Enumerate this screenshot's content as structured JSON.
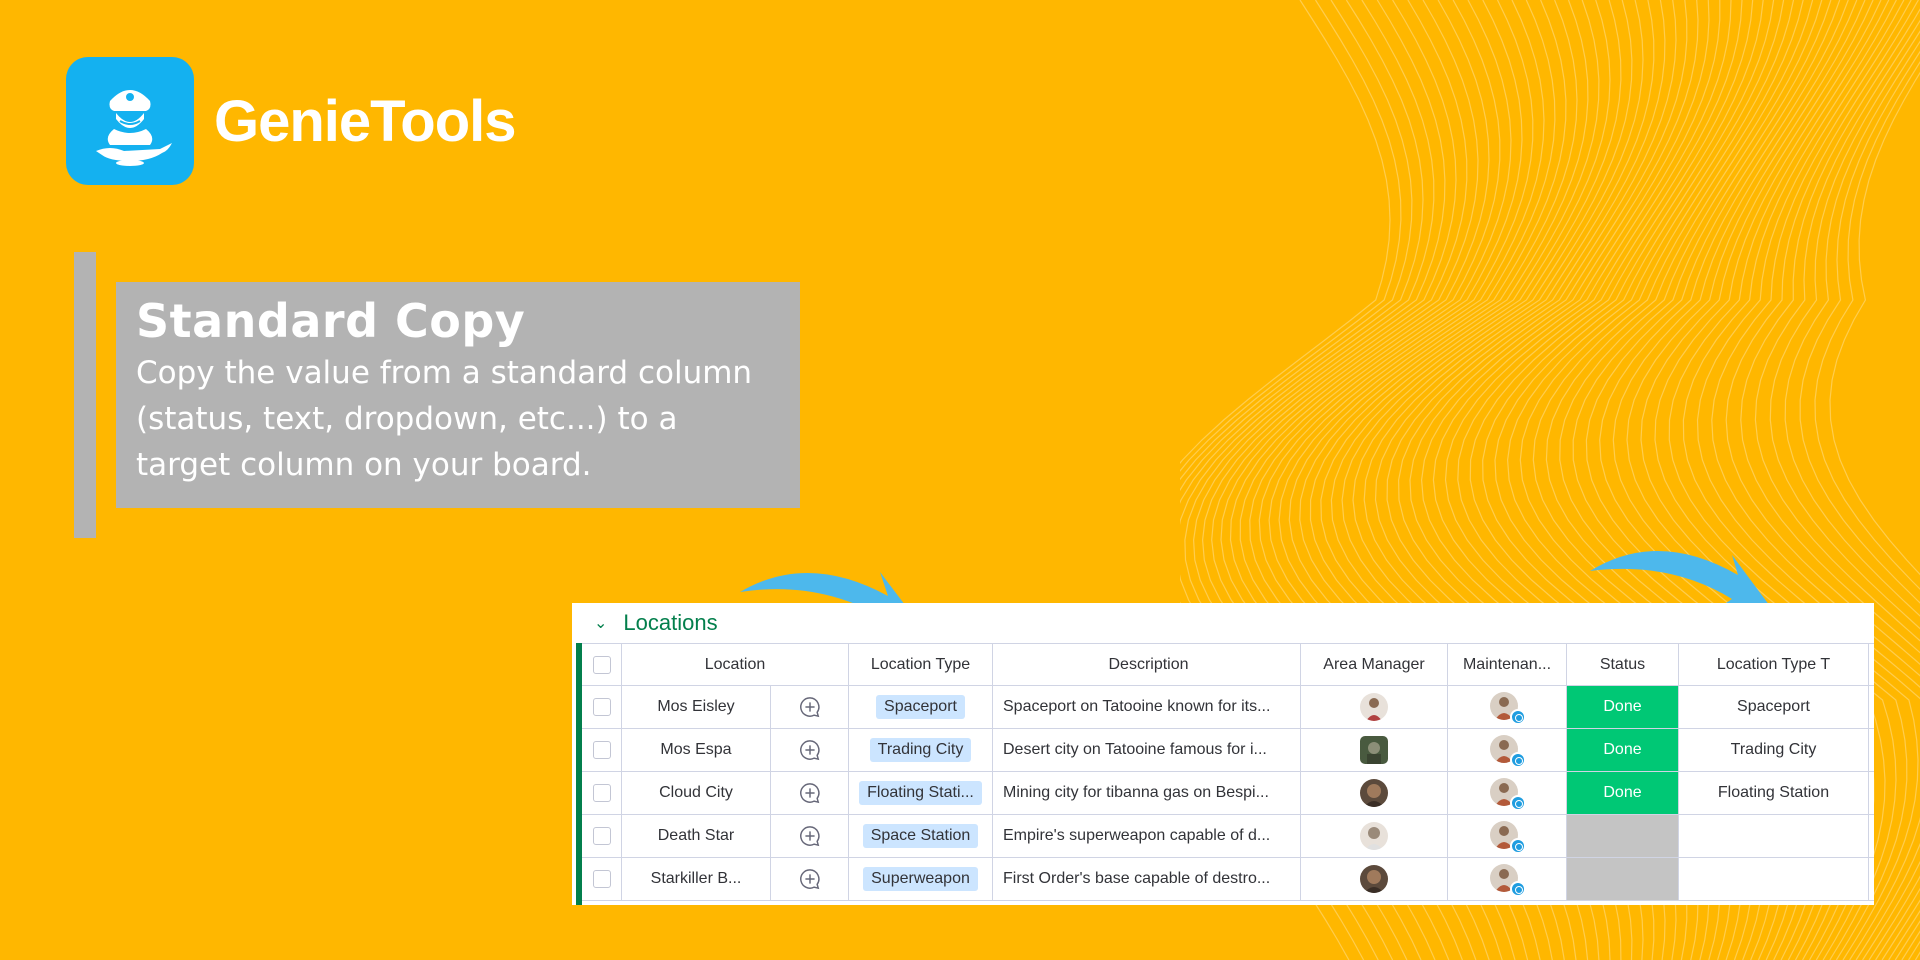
{
  "brand": {
    "name": "GenieTools",
    "logo_icon": "genie-lamp-icon",
    "logo_color": "#14B1F0"
  },
  "card": {
    "title": "Standard Copy",
    "description": "Copy the value from a standard column (status, text, dropdown, etc...) to a target column on your board."
  },
  "colors": {
    "background": "#FFB700",
    "group": "#037F4C",
    "done": "#00C875",
    "tag": "#CCE5FF",
    "arrow": "#4DB8EC"
  },
  "board": {
    "group_title": "Locations",
    "columns": {
      "location": "Location",
      "location_type": "Location Type",
      "description": "Description",
      "area_manager": "Area Manager",
      "maintenance": "Maintenan...",
      "status": "Status",
      "location_type_t": "Location Type T"
    },
    "rows": [
      {
        "location": "Mos Eisley",
        "type": "Spaceport",
        "description": "Spaceport on Tatooine known for its...",
        "status": "Done",
        "target": "Spaceport"
      },
      {
        "location": "Mos Espa",
        "type": "Trading City",
        "description": "Desert city on Tatooine famous for i...",
        "status": "Done",
        "target": "Trading City"
      },
      {
        "location": "Cloud City",
        "type": "Floating Stati...",
        "description": "Mining city for tibanna gas on Bespi...",
        "status": "Done",
        "target": "Floating Station"
      },
      {
        "location": "Death Star",
        "type": "Space Station",
        "description": "Empire's superweapon capable of d...",
        "status": "",
        "target": ""
      },
      {
        "location": "Starkiller B...",
        "type": "Superweapon",
        "description": "First Order's base capable of destro...",
        "status": "",
        "target": ""
      }
    ]
  }
}
